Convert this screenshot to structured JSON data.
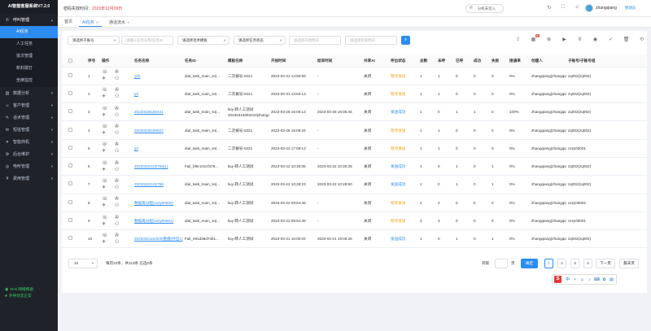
{
  "app": {
    "title": "AI智能客服系统V7.2.0"
  },
  "sidebar": {
    "groups": [
      {
        "label": "呼叫管理",
        "icon": "phone-icon",
        "open": true,
        "items": [
          {
            "label": "AI任务",
            "active": true
          },
          {
            "label": "人工任务",
            "active": false
          },
          {
            "label": "批次管理",
            "active": false
          },
          {
            "label": "新封拨打",
            "active": false
          },
          {
            "label": "坐席监控",
            "active": false
          }
        ]
      },
      {
        "label": "数据分析",
        "icon": "chart-icon"
      },
      {
        "label": "客户管理",
        "icon": "user-icon"
      },
      {
        "label": "话术管理",
        "icon": "script-icon"
      },
      {
        "label": "短信管理",
        "icon": "sms-icon"
      },
      {
        "label": "智能商机",
        "icon": "bulb-icon"
      },
      {
        "label": "后台维护",
        "icon": "tool-icon"
      },
      {
        "label": "电听管理",
        "icon": "headset-icon"
      },
      {
        "label": "费用管理",
        "icon": "money-icon"
      }
    ],
    "status": [
      {
        "label": "0ms 网络畅通"
      },
      {
        "label": "外呼状态正常"
      }
    ]
  },
  "topbar": {
    "expire_prefix": "密码失效时间：",
    "expire_date": "2023年12月09日",
    "seat_label": "分机未签入",
    "username": "zhangqiang",
    "role": "管理员"
  },
  "tabs": [
    {
      "label": "首页",
      "active": false
    },
    {
      "label": "AI任务",
      "active": true,
      "closable": true
    },
    {
      "label": "通话流水",
      "active": false,
      "closable": true
    }
  ],
  "filters": [
    {
      "value": "请选择子账号",
      "placeholder": false,
      "dropdown": true
    },
    {
      "value": "请输入任务名称/任务ID",
      "placeholder": true,
      "dropdown": false
    },
    {
      "value": "请选择话术模板",
      "placeholder": false,
      "dropdown": true
    },
    {
      "value": "请选择任务状态",
      "placeholder": false,
      "dropdown": true
    },
    {
      "value": "请选择开始时间",
      "placeholder": true,
      "dropdown": false
    },
    {
      "value": "请选择结束时间",
      "placeholder": true,
      "dropdown": false
    }
  ],
  "toolbar_badge": "新",
  "table": {
    "columns": [
      "序号",
      "操作",
      "任务名称",
      "任务ID",
      "模板名称",
      "开始时间",
      "结束时间",
      "共享AI",
      "呼出状态",
      "总数",
      "未呼",
      "已呼",
      "成功",
      "失败",
      "接通率",
      "创建人",
      "子账号/子账号组"
    ],
    "rows": [
      {
        "no": "1",
        "name": "yd2",
        "id": "dial_task_main_sn|...",
        "template": "二次拨号-0221",
        "start": "2023-03-31 13:50:59",
        "end": "-",
        "shared": "关闭",
        "status": "暂停发送",
        "status_type": "warn",
        "total": "1",
        "uncalled": "1",
        "called": "0",
        "success": "0",
        "fail": "0",
        "rate": "0%",
        "creator": "zhangqiang(zhangqiang)",
        "sub": "zq002(zq002)"
      },
      {
        "no": "2",
        "name": "yd",
        "id": "dial_task_main_sn|...",
        "template": "二次拨号-0221",
        "start": "2023-03-31 13:50:13",
        "end": "-",
        "shared": "关闭",
        "status": "暂停发送",
        "status_type": "warn",
        "total": "1",
        "uncalled": "1",
        "called": "0",
        "success": "0",
        "fail": "0",
        "rate": "0%",
        "creator": "zhangqiang(zhangqiang)",
        "sub": "zq002(zq002)"
      },
      {
        "no": "3",
        "name": "20230328160441",
        "id": "dial_task_main_sn|...",
        "template": "liuy-转人工测试20230316093216|zhangqiang",
        "start": "2023-03-28 16:05:13",
        "end": "2023-03-28 16:05:46",
        "shared": "关闭",
        "status": "发送成功",
        "status_type": "ok",
        "total": "1",
        "uncalled": "0",
        "called": "1",
        "success": "1",
        "fail": "0",
        "rate": "100%",
        "creator": "zhangqiang(zhangqiang)",
        "sub": "zq002(zq002)"
      },
      {
        "no": "4",
        "name": "20230328150627",
        "id": "dial_task_main_sn|...",
        "template": "二次拨号-0221",
        "start": "2023-03-28 15:06:34",
        "end": "-",
        "shared": "关闭",
        "status": "暂停发送",
        "status_type": "warn",
        "total": "1",
        "uncalled": "1",
        "called": "0",
        "success": "0",
        "fail": "0",
        "rate": "0%",
        "creator": "zhangqiang(zhangqiang)",
        "sub": "zq002(zq002)"
      },
      {
        "no": "5",
        "name": "yd",
        "id": "dial_task_main_sn|...",
        "template": "二次拨号-0221",
        "start": "2023-03-22 17:08:13",
        "end": "-",
        "shared": "关闭",
        "status": "暂停发送",
        "status_type": "warn",
        "total": "1",
        "uncalled": "1",
        "called": "0",
        "success": "0",
        "fail": "0",
        "rate": "0%",
        "creator": "zhangqiang(zhangqiang)",
        "sub": "cszy00001"
      },
      {
        "no": "6",
        "name": "20230322102759(1)",
        "id": "Fail_bf6c10ccf378...",
        "template": "liuy-转人工测试",
        "start": "2023-03-22 10:30:05",
        "end": "2023-03-22 10:30:35",
        "shared": "关闭",
        "status": "发送成功",
        "status_type": "ok",
        "total": "1",
        "uncalled": "0",
        "called": "1",
        "success": "0",
        "fail": "1",
        "rate": "0%",
        "creator": "zhangqiang(zhangqiang)",
        "sub": "zq002(zq002)"
      },
      {
        "no": "7",
        "name": "20230322102759",
        "id": "dial_task_main_sn|...",
        "template": "liuy-转人工测试",
        "start": "2023-03-22 10:28:23",
        "end": "2023-03-22 10:28:50",
        "shared": "关闭",
        "status": "发送成功",
        "status_type": "ok",
        "total": "1",
        "uncalled": "0",
        "called": "1",
        "success": "0",
        "fail": "1",
        "rate": "0%",
        "creator": "zhangqiang(zhangqiang)",
        "sub": "zq002(zq002)"
      },
      {
        "no": "8",
        "name": "数据再分配(cszy00002)",
        "id": "dial_task_main_sn|...",
        "template": "liuy-转人工测试",
        "start": "2023-03-22 09:54:48",
        "end": "-",
        "shared": "关闭",
        "status": "暂停发送",
        "status_type": "warn",
        "total": "2",
        "uncalled": "2",
        "called": "0",
        "success": "0",
        "fail": "0",
        "rate": "0%",
        "creator": "zhangqiang(zhangqiang)",
        "sub": "cszy00002"
      },
      {
        "no": "9",
        "name": "数据再分配(cszy00001)",
        "id": "dial_task_main_sn|...",
        "template": "liuy-转人工测试",
        "start": "2023-03-22 09:54:48",
        "end": "-",
        "shared": "关闭",
        "status": "暂停发送",
        "status_type": "warn",
        "total": "3",
        "uncalled": "3",
        "called": "0",
        "success": "0",
        "fail": "0",
        "rate": "0%",
        "creator": "zhangqiang(zhangqiang)",
        "sub": "cszy00001"
      },
      {
        "no": "10",
        "name": "20230321164030重播(呼出1)",
        "id": "Fail_e91d36d74b1...",
        "template": "liuy-转人工测试",
        "start": "2023-03-21 19:00:04",
        "end": "2023-03-21 19:00:26",
        "shared": "关闭",
        "status": "发送成功",
        "status_type": "ok",
        "total": "1",
        "uncalled": "0",
        "called": "1",
        "success": "0",
        "fail": "1",
        "rate": "0%",
        "creator": "zhangqiang(zhangqiang)",
        "sub": "zq002(zq002)"
      }
    ]
  },
  "pagination": {
    "page_size": "10",
    "info": "每页10条，共113条  已选0条",
    "goto_prefix": "到第",
    "goto_suffix": "页",
    "confirm": "确定",
    "pages": [
      "1",
      "2",
      "3",
      "4"
    ],
    "current": "1",
    "next": "下一页",
    "last": "最末页"
  }
}
